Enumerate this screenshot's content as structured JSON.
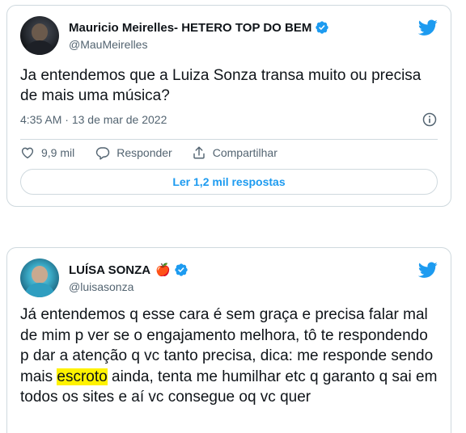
{
  "tweets": [
    {
      "author_name": "Mauricio Meirelles- HETERO TOP DO BEM",
      "handle": "@MauMeirelles",
      "verified": true,
      "text": "Ja entendemos que a Luiza Sonza transa muito ou precisa de mais uma música?",
      "time": "4:35 AM",
      "separator": " · ",
      "date": "13 de mar de 2022",
      "likes": "9,9 mil",
      "reply_label": "Responder",
      "share_label": "Compartilhar",
      "read_replies": "Ler 1,2 mil respostas"
    },
    {
      "author_name": "LUÍSA SONZA",
      "name_emoji": "🍎",
      "handle": "@luisasonza",
      "verified": true,
      "text_before": "Já entendemos q esse cara é sem graça e precisa falar mal de mim p ver se o engajamento melhora, tô te respondendo p dar a atenção q vc tanto precisa, dica: me responde sendo mais ",
      "text_highlight": "escroto",
      "text_after": " ainda, tenta me humilhar etc q garanto q sai em todos os sites e aí vc consegue oq vc quer"
    }
  ],
  "icons": {
    "verified": "verified-badge-icon",
    "bird": "twitter-bird-icon",
    "info": "info-icon",
    "like": "heart-icon",
    "reply": "reply-bubble-icon",
    "share": "share-icon"
  },
  "colors": {
    "accent": "#1d9bf0",
    "text": "#0f1419",
    "muted": "#536471",
    "border": "#cfd9de",
    "highlight": "#fff200"
  }
}
